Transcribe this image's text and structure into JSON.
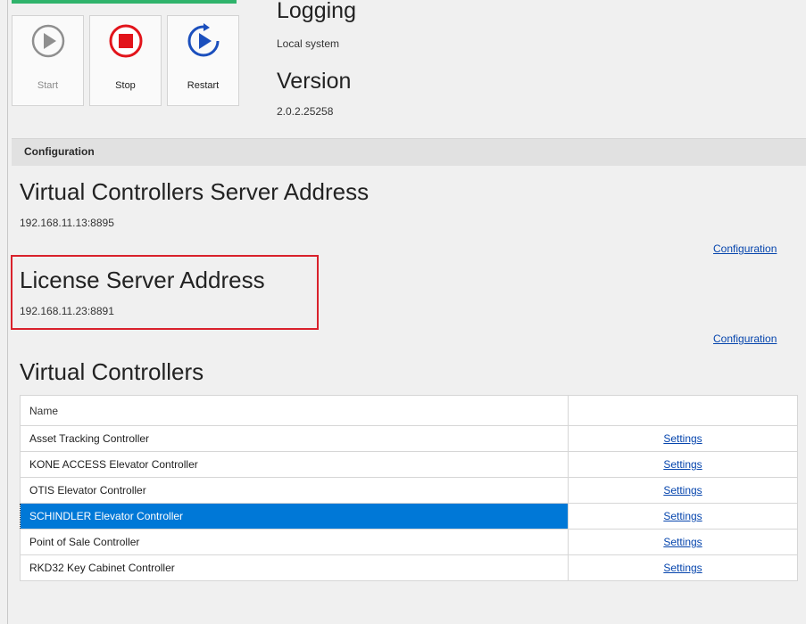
{
  "service": {
    "buttons": [
      {
        "label": "Start",
        "icon": "play-icon",
        "enabled": false
      },
      {
        "label": "Stop",
        "icon": "stop-icon",
        "enabled": true
      },
      {
        "label": "Restart",
        "icon": "restart-icon",
        "enabled": true
      }
    ],
    "logging_title": "Logging",
    "logging_value": "Local system",
    "version_title": "Version",
    "version_value": "2.0.2.25258"
  },
  "configuration": {
    "header": "Configuration",
    "virtual_server_title": "Virtual Controllers Server Address",
    "virtual_server_address": "192.168.11.13:8895",
    "virtual_server_link": "Configuration",
    "license_server_title": "License Server Address",
    "license_server_address": "192.168.11.23:8891",
    "license_server_link": "Configuration"
  },
  "controllers": {
    "title": "Virtual Controllers",
    "columns": [
      "Name",
      ""
    ],
    "rows": [
      {
        "name": "Asset Tracking Controller",
        "action": "Settings"
      },
      {
        "name": "KONE ACCESS Elevator Controller",
        "action": "Settings"
      },
      {
        "name": "OTIS Elevator Controller",
        "action": "Settings"
      },
      {
        "name": "SCHINDLER Elevator Controller",
        "action": "Settings"
      },
      {
        "name": "Point of Sale Controller",
        "action": "Settings"
      },
      {
        "name": "RKD32 Key Cabinet Controller",
        "action": "Settings"
      }
    ],
    "selected_row": 3
  },
  "colors": {
    "accent_green": "#2fb36b",
    "stop_red": "#e2141b",
    "restart_blue": "#1b4fbd",
    "selection_blue": "#0078d7",
    "link_blue": "#0645ad",
    "highlight_red": "#d9212b"
  }
}
